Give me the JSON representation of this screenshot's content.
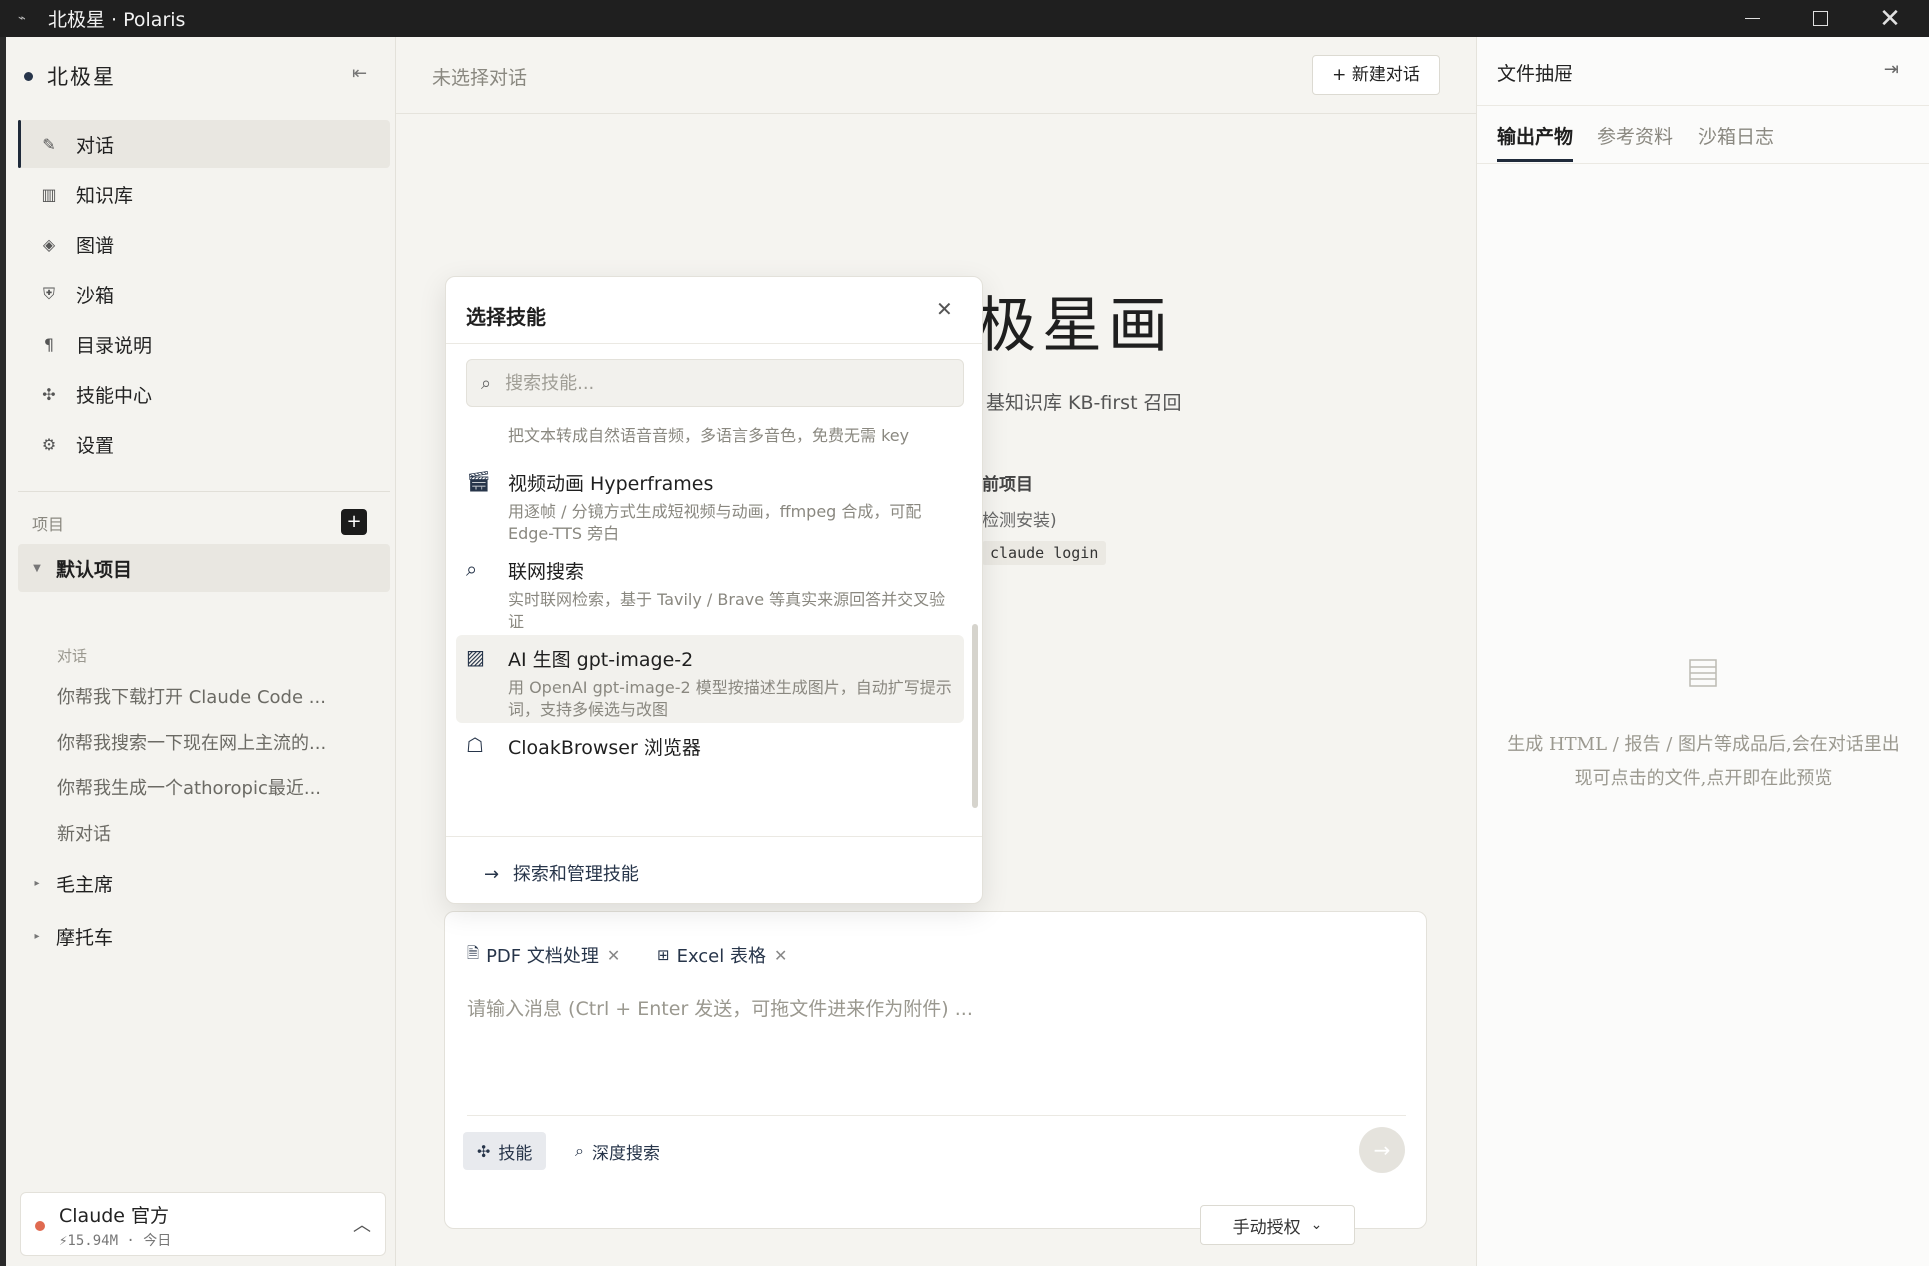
{
  "window": {
    "title": "北极星 · Polaris"
  },
  "sidebar": {
    "brand": "北极星",
    "nav": [
      {
        "label": "对话",
        "icon": "pencil-icon",
        "active": true
      },
      {
        "label": "知识库",
        "icon": "columns-icon"
      },
      {
        "label": "图谱",
        "icon": "diamond-icon"
      },
      {
        "label": "沙箱",
        "icon": "shield-icon"
      },
      {
        "label": "目录说明",
        "icon": "pilcrow-icon"
      },
      {
        "label": "技能中心",
        "icon": "puzzle-icon"
      },
      {
        "label": "设置",
        "icon": "gear-icon"
      }
    ],
    "projects_heading": "项目",
    "projects": [
      {
        "name": "默认项目",
        "expanded": true
      },
      {
        "name": "毛主席",
        "expanded": false
      },
      {
        "name": "摩托车",
        "expanded": false
      }
    ],
    "conversations_label": "对话",
    "conversations": [
      "你帮我下载打开 Claude Code ...",
      "你帮我搜索一下现在网上主流的...",
      "你帮我生成一个athoropic最近...",
      "新对话"
    ],
    "model": {
      "name": "Claude 官方",
      "meta": "⚡15.94M · 今日",
      "status_color": "#e06a50"
    }
  },
  "main": {
    "header_status": "未选择对话",
    "new_chat": "+ 新建对话",
    "welcome_title": "极星画",
    "subtitle": "基知识库 KB-first 召回",
    "hint_bold": "前项目",
    "hint_text": "检测安装)",
    "code_hint": "claude login",
    "composer": {
      "chips": [
        {
          "label": "PDF 文档处理",
          "icon": "document-icon"
        },
        {
          "label": "Excel 表格",
          "icon": "table-icon"
        }
      ],
      "placeholder": "请输入消息 (Ctrl + Enter 发送，可拖文件进来作为附件) ...",
      "skill_button": "技能",
      "deep_search_button": "深度搜索"
    },
    "auth_button": "手动授权"
  },
  "drawer": {
    "title": "文件抽屉",
    "tabs": [
      {
        "label": "输出产物",
        "active": true
      },
      {
        "label": "参考资料",
        "active": false
      },
      {
        "label": "沙箱日志",
        "active": false
      }
    ],
    "empty_text": "生成 HTML / 报告 / 图片等成品后,会在对话里出现可点击的文件,点开即在此预览"
  },
  "skill_popup": {
    "title": "选择技能",
    "search_placeholder": "搜索技能...",
    "skills": [
      {
        "name": "",
        "desc": "把文本转成自然语音音频，多语言多音色，免费无需 key",
        "icon": ""
      },
      {
        "name": "视频动画 Hyperframes",
        "desc": "用逐帧 / 分镜方式生成短视频与动画，ffmpeg 合成，可配 Edge-TTS 旁白",
        "icon": "clapperboard-icon"
      },
      {
        "name": "联网搜索",
        "desc": "实时联网检索，基于 Tavily / Brave 等真实来源回答并交叉验证",
        "icon": "search-icon"
      },
      {
        "name": "AI 生图 gpt-image-2",
        "desc": "用 OpenAI gpt-image-2 模型按描述生成图片，自动扩写提示词，支持多候选与改图",
        "icon": "image-icon",
        "highlighted": true
      },
      {
        "name": "CloakBrowser 浏览器",
        "desc": "",
        "icon": "ghost-icon"
      }
    ],
    "footer_link": "探索和管理技能"
  }
}
